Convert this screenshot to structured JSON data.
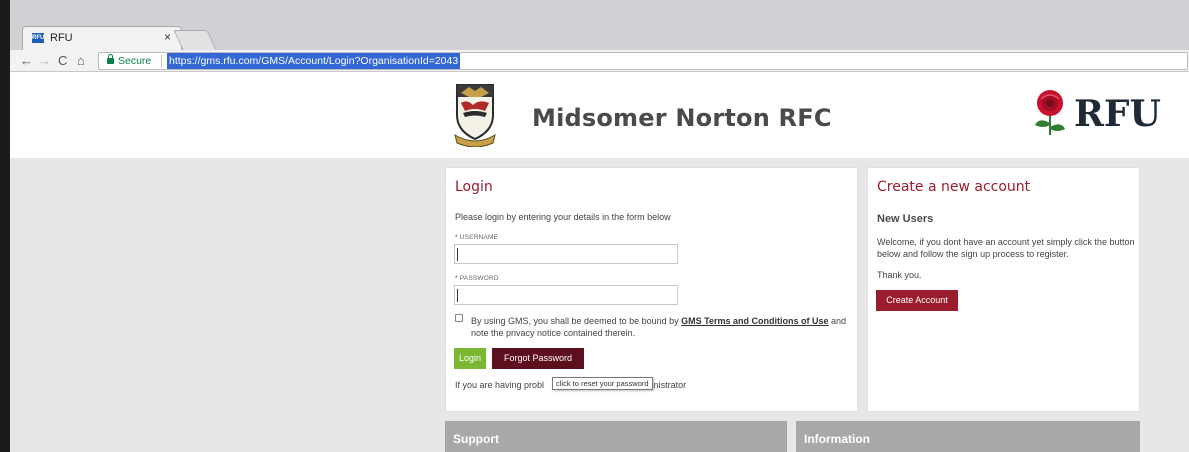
{
  "browser": {
    "tab_title": "RFU",
    "tab_close": "×",
    "favicon_text": "RFU",
    "secure_label": "Secure",
    "url": "https://gms.rfu.com/GMS/Account/Login?OrganisationId=2043",
    "nav": {
      "back": "←",
      "forward": "→",
      "reload": "C",
      "home": "⌂"
    }
  },
  "header": {
    "club_name": "Midsomer Norton RFC",
    "rfu_logo_text": "RFU"
  },
  "login": {
    "title": "Login",
    "intro": "Please login by entering your details in the form below",
    "username_label": "USERNAME",
    "password_label": "PASSWORD",
    "required_marker": "*",
    "username_value": "",
    "password_value": "",
    "terms_prefix": "By using GMS, you shall be deemed to be bound by ",
    "terms_link": "GMS Terms and Conditions of Use",
    "terms_suffix": " and note the privacy notice contained therein.",
    "login_button": "Login",
    "forgot_button": "Forgot Password",
    "help_text": "If you are having probl                                        ministrator",
    "tooltip": "click to reset your password"
  },
  "create_account": {
    "title": "Create a new account",
    "subtitle": "New Users",
    "welcome": "Welcome, if you dont have an account yet simply click the button below and follow the sign up process to register.",
    "thanks": "Thank you.",
    "button": "Create Account"
  },
  "footer_panels": {
    "support": "Support",
    "information": "Information"
  },
  "colors": {
    "brand_red": "#9b1c2c",
    "login_green": "#7ab733",
    "forgot_maroon": "#5e0f1d",
    "panel_gray": "#a7a8aa"
  }
}
